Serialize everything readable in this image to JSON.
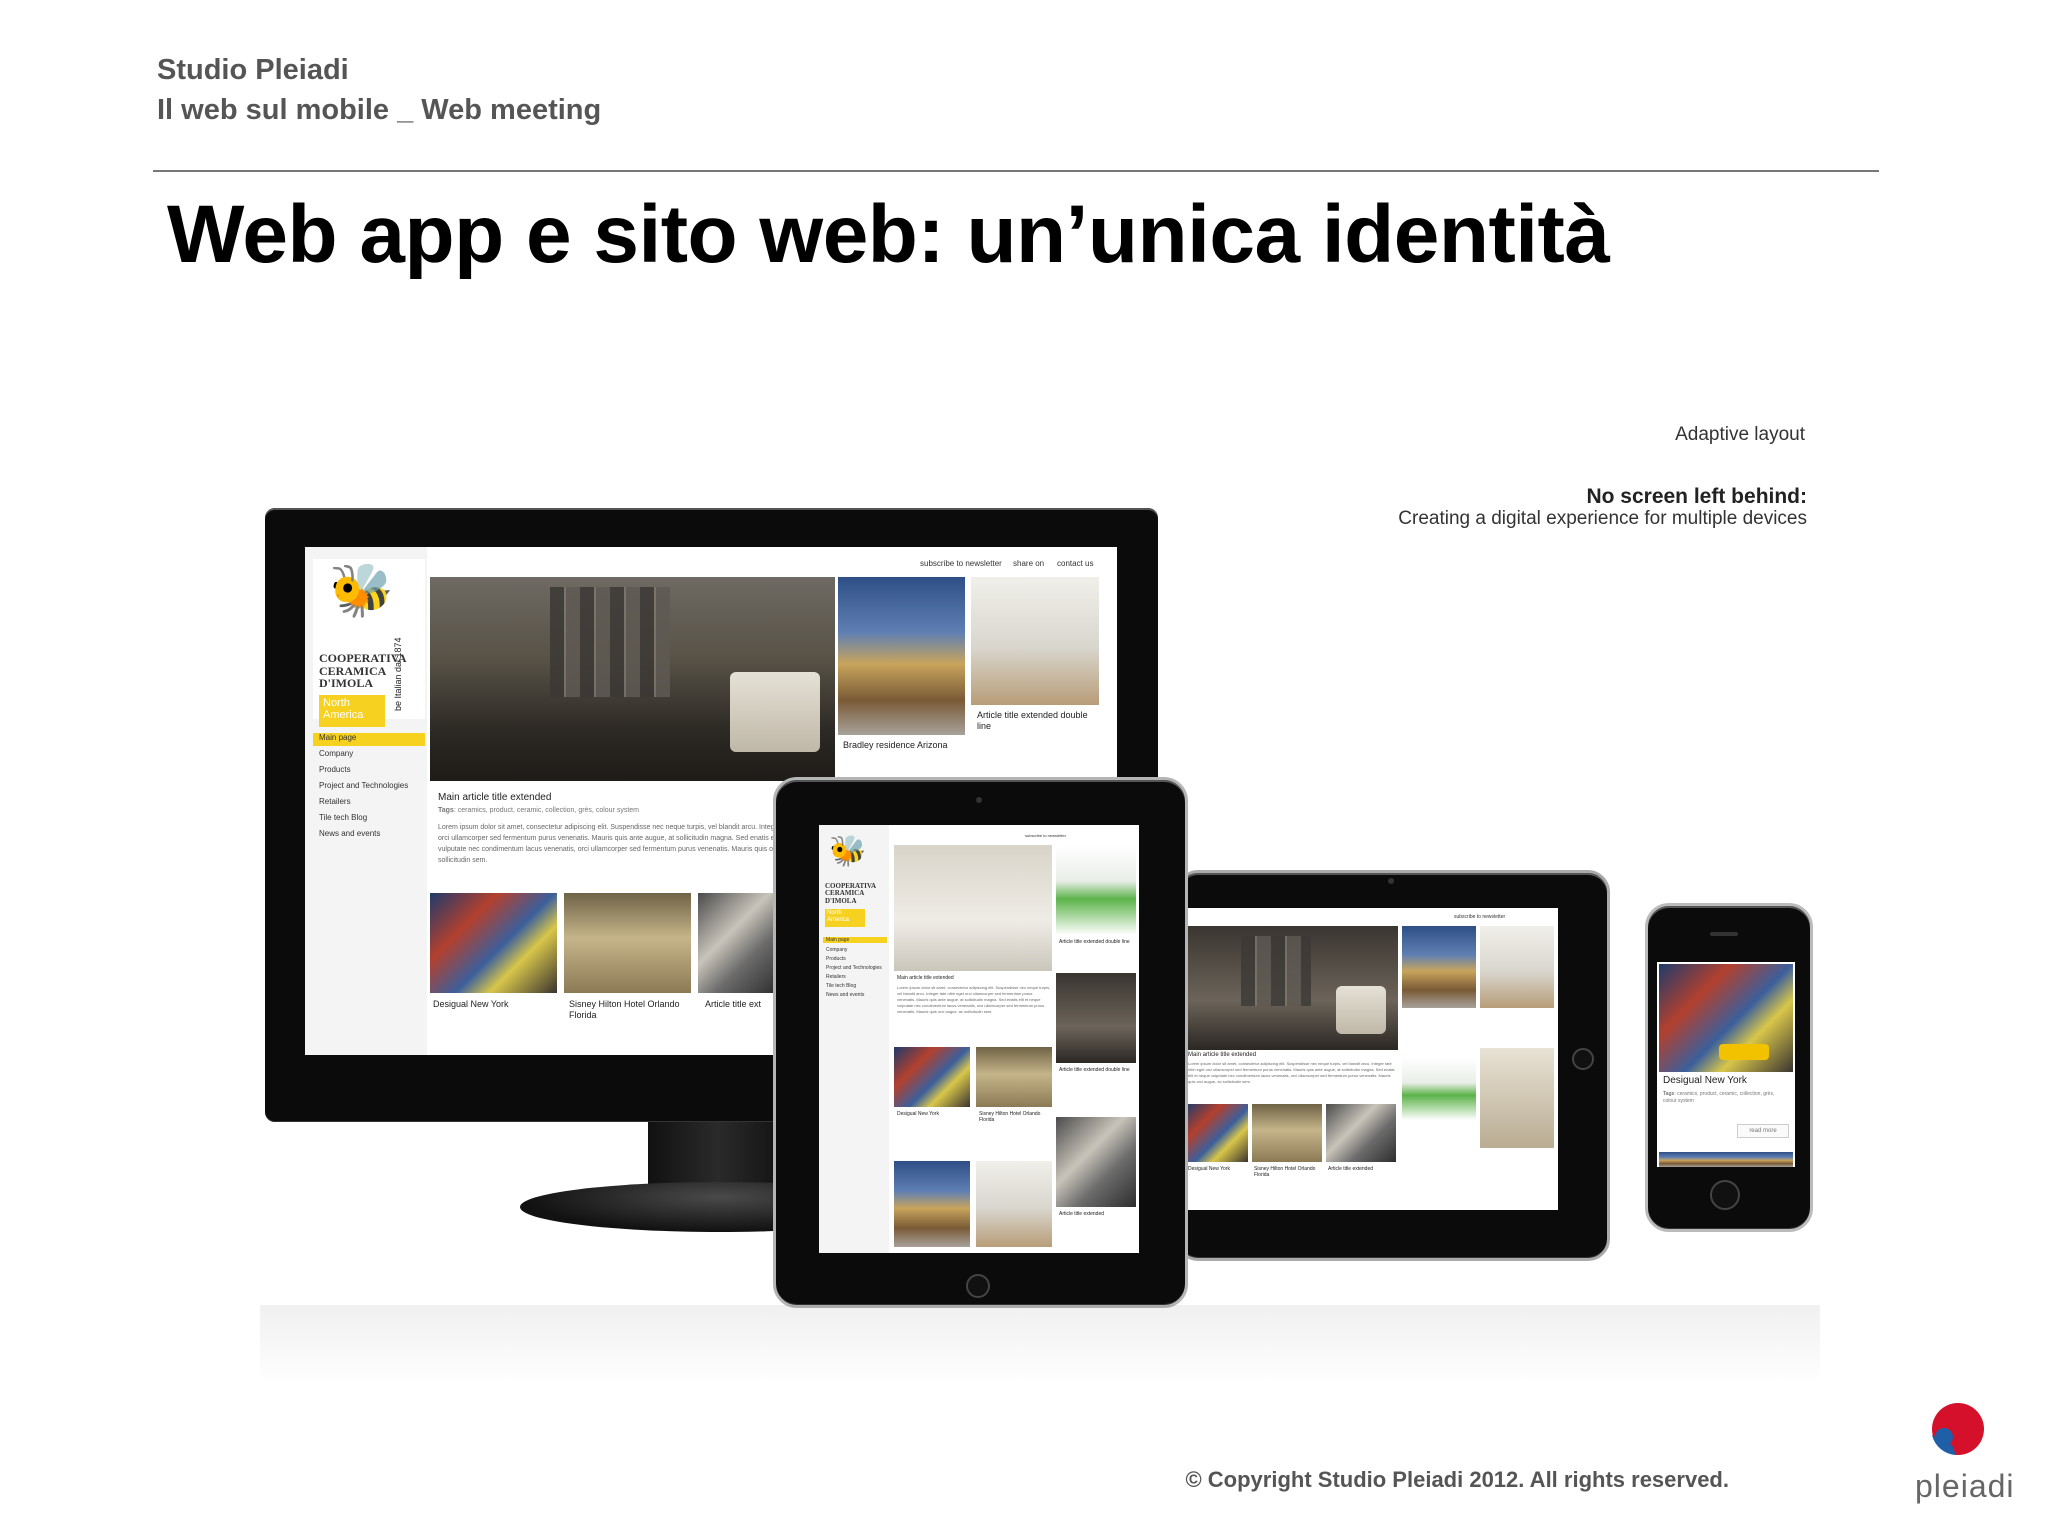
{
  "header": {
    "studio": "Studio Pleiadi",
    "subtitle": "Il web sul mobile _ Web meeting",
    "title": "Web app e sito web: un’unica identità"
  },
  "taglines": {
    "adaptive": "Adaptive layout",
    "headline": "No screen left behind:",
    "sub": "Creating a digital experience for multiple devices"
  },
  "site": {
    "brand_line1": "COOPERATIVA",
    "brand_line2": "CERAMICA",
    "brand_line3": "D'IMOLA",
    "vertical_tag": "be Italian dal 1874",
    "region_line1": "North",
    "region_line2": "America",
    "nav": [
      "Main page",
      "Company",
      "Products",
      "Project and Technologies",
      "Retailers",
      "Tile tech Blog",
      "News and events"
    ],
    "topbar": [
      "subscribe to newsletter",
      "share on",
      "contact us"
    ],
    "main_title": "Main article title extended",
    "tags_label": "Tags",
    "tags_text": "ceramics, product, ceramic, collection, grès, colour system",
    "lorem": "Lorem ipsum dolor sit amet, consectetur adipiscing elit. Suspendisse nec neque turpis, vel blandit arcu. Integer tate nibh eget orci ullamcorper sed fermentum purus venenatis. Mauris quis ante augue, at sollicitudin magna. Sed enatis elit et neque vulputate nec condimentum lacus venenatis, orci ullamcorper sed fermentum purus venenatis. Mauris quis orci augue, ac sollicitudin sem.",
    "card_bradley": "Bradley residence Arizona",
    "card_article_double": "Article title extended double line",
    "card_desigual": "Desigual New York",
    "card_hilton": "Sisney Hilton Hotel Orlando Florida",
    "card_article_ext": "Article title ext",
    "card_article_extended": "Article title extended",
    "read_more": "read more"
  },
  "footer": {
    "copyright": "© Copyright Studio Pleiadi 2012. All rights reserved.",
    "logo_text": "pleiadi"
  }
}
